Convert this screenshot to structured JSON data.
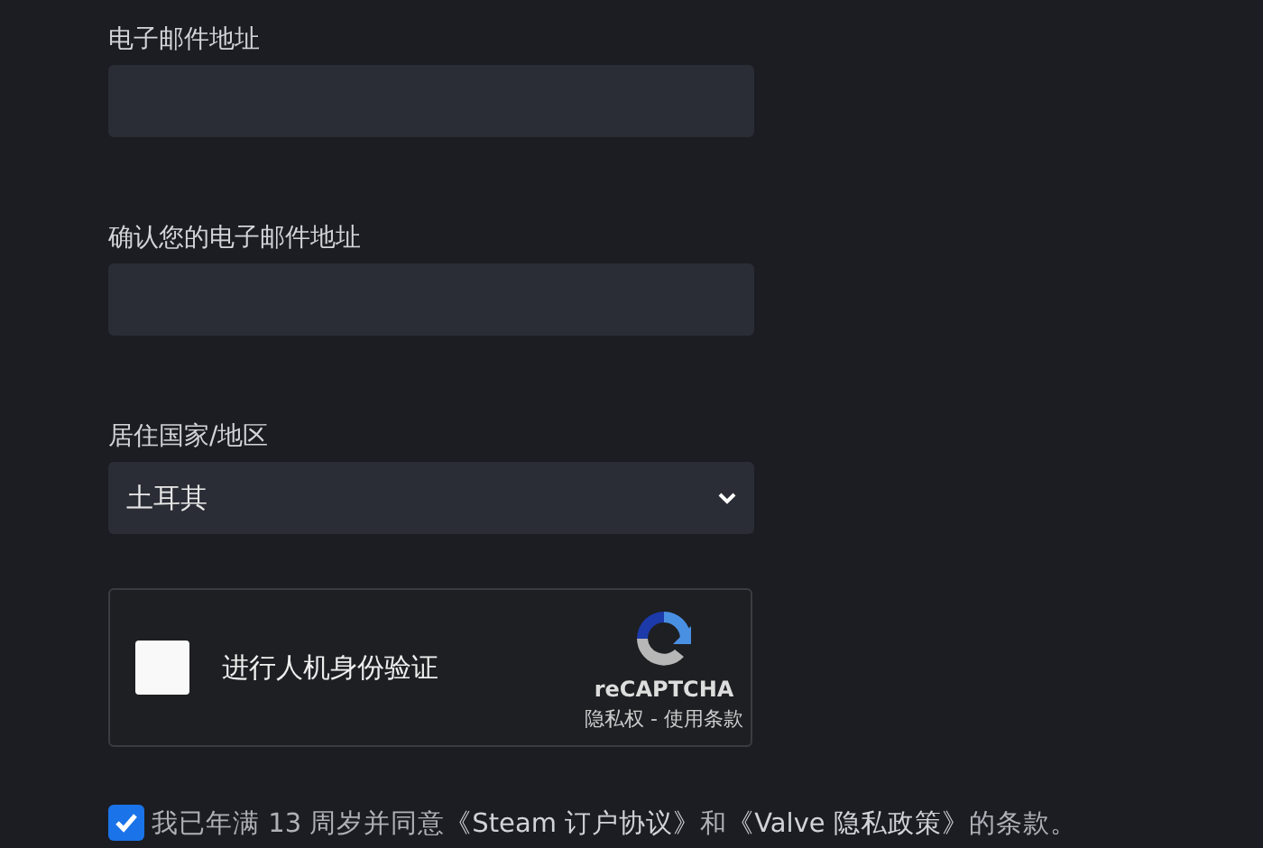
{
  "fields": [
    {
      "kind": "input",
      "label": "电子邮件地址"
    },
    {
      "kind": "input",
      "label": "确认您的电子邮件地址"
    },
    {
      "kind": "select",
      "label": "居住国家/地区",
      "value": "土耳其"
    }
  ],
  "captcha": {
    "checked": false,
    "label": "进行人机身份验证",
    "brand": "reCAPTCHA",
    "footer": "隐私权 - 使用条款"
  },
  "agreement": {
    "checked": true,
    "text_before": "我已年满 13 周岁并同意",
    "link_1": "《Steam 订户协议》",
    "middle": "和",
    "link_2": "《Valve 隐私政策》",
    "text_after": "的条款。"
  }
}
